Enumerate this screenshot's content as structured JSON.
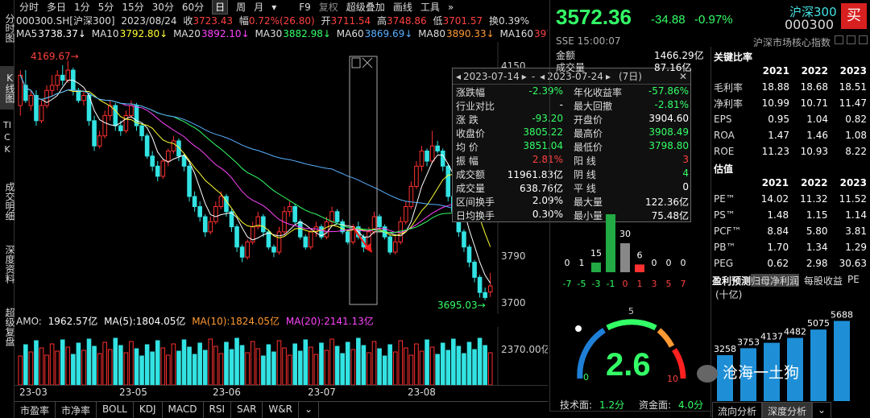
{
  "left_tabs": [
    {
      "label": "分时图",
      "active": false
    },
    {
      "label": "K线图",
      "active": true
    },
    {
      "label": "TICK",
      "active": false
    },
    {
      "label": "成交明细",
      "active": false
    },
    {
      "label": "深度资料",
      "active": false
    },
    {
      "label": "超级复盘",
      "active": false
    }
  ],
  "toolbar": {
    "periods": [
      "分时",
      "多日",
      "1分",
      "5分",
      "15分",
      "30分",
      "60分",
      "日",
      "周",
      "月"
    ],
    "selected": "日",
    "more": "▾",
    "right": [
      "F9",
      "复权",
      "超级叠加",
      "画线",
      "工具"
    ],
    "chevron": "»"
  },
  "info": {
    "code": "000300.SH[沪深300]",
    "date": "2023/08/24",
    "close_label": "收",
    "close": "3723.43",
    "amp_label": "幅",
    "amp": "0.72%(26.80)",
    "open_label": "开",
    "open": "3711.54",
    "high_label": "高",
    "high": "3748.86",
    "low_label": "低",
    "low": "3701.57",
    "turnover_label": "换",
    "turnover": "0.39%"
  },
  "ma": [
    {
      "name": "MA5",
      "value": "3738.37↓",
      "color": "#ffffff"
    },
    {
      "name": "MA10",
      "value": "3792.80↓",
      "color": "#ffff33"
    },
    {
      "name": "MA20",
      "value": "3892.10↓",
      "color": "#ff44ff"
    },
    {
      "name": "MA30",
      "value": "3882.98↓",
      "color": "#33ff66"
    },
    {
      "name": "MA60",
      "value": "3869.69↓",
      "color": "#58b0ff"
    },
    {
      "name": "MA80",
      "value": "3890.33↓",
      "color": "#ff9933"
    },
    {
      "name": "MA160",
      "value": "3974.2",
      "color": "#ff4040"
    }
  ],
  "chart_data": {
    "type": "candlestick",
    "ylim": [
      3680,
      4190
    ],
    "y_ticks": [
      "4150",
      "3790",
      "3700"
    ],
    "x_ticks": [
      "23-03",
      "23-05",
      "23-06",
      "23-07",
      "23-08"
    ],
    "annotations": {
      "max_label": "4169.67→",
      "min_label": "3695.03→"
    },
    "candles": [
      [
        4080,
        4140,
        4060,
        4150
      ],
      [
        4120,
        4090,
        4085,
        4150
      ],
      [
        4080,
        4100,
        4070,
        4110
      ],
      [
        4100,
        4050,
        4040,
        4110
      ],
      [
        4050,
        4080,
        4045,
        4090
      ],
      [
        4080,
        4110,
        4075,
        4120
      ],
      [
        4110,
        4120,
        4100,
        4140
      ],
      [
        4120,
        4140,
        4110,
        4150
      ],
      [
        4140,
        4130,
        4120,
        4160
      ],
      [
        4130,
        4150,
        4125,
        4169
      ],
      [
        4150,
        4110,
        4100,
        4155
      ],
      [
        4110,
        4090,
        4085,
        4115
      ],
      [
        4090,
        4100,
        4080,
        4110
      ],
      [
        4100,
        4050,
        4040,
        4105
      ],
      [
        4050,
        4000,
        3990,
        4060
      ],
      [
        4000,
        4020,
        3995,
        4030
      ],
      [
        4020,
        4060,
        4015,
        4070
      ],
      [
        4060,
        4080,
        4050,
        4090
      ],
      [
        4080,
        4040,
        4030,
        4085
      ],
      [
        4040,
        4030,
        4020,
        4050
      ],
      [
        4030,
        4060,
        4025,
        4070
      ],
      [
        4060,
        4080,
        4055,
        4090
      ],
      [
        4080,
        4040,
        4030,
        4085
      ],
      [
        4040,
        4020,
        4010,
        4045
      ],
      [
        4020,
        3980,
        3975,
        4025
      ],
      [
        3980,
        3960,
        3950,
        3990
      ],
      [
        3960,
        3940,
        3930,
        3970
      ],
      [
        3940,
        3970,
        3935,
        3975
      ],
      [
        3970,
        3990,
        3960,
        3995
      ],
      [
        3990,
        4010,
        3985,
        4020
      ],
      [
        4010,
        3980,
        3970,
        4015
      ],
      [
        3980,
        3960,
        3950,
        3985
      ],
      [
        3960,
        3900,
        3890,
        3965
      ],
      [
        3900,
        3880,
        3870,
        3910
      ],
      [
        3880,
        3860,
        3850,
        3890
      ],
      [
        3860,
        3830,
        3820,
        3865
      ],
      [
        3830,
        3850,
        3825,
        3860
      ],
      [
        3850,
        3880,
        3845,
        3890
      ],
      [
        3880,
        3900,
        3875,
        3910
      ],
      [
        3900,
        3870,
        3860,
        3905
      ],
      [
        3870,
        3840,
        3830,
        3875
      ],
      [
        3840,
        3800,
        3790,
        3845
      ],
      [
        3800,
        3780,
        3770,
        3805
      ],
      [
        3780,
        3810,
        3775,
        3815
      ],
      [
        3810,
        3840,
        3805,
        3850
      ],
      [
        3840,
        3860,
        3835,
        3870
      ],
      [
        3860,
        3830,
        3820,
        3865
      ],
      [
        3830,
        3800,
        3795,
        3835
      ],
      [
        3800,
        3790,
        3780,
        3805
      ],
      [
        3790,
        3830,
        3785,
        3840
      ],
      [
        3830,
        3870,
        3825,
        3880
      ],
      [
        3870,
        3880,
        3860,
        3890
      ],
      [
        3880,
        3850,
        3845,
        3885
      ],
      [
        3850,
        3820,
        3815,
        3855
      ],
      [
        3820,
        3800,
        3795,
        3825
      ],
      [
        3800,
        3830,
        3795,
        3835
      ],
      [
        3830,
        3840,
        3820,
        3850
      ],
      [
        3840,
        3820,
        3815,
        3845
      ],
      [
        3820,
        3850,
        3815,
        3860
      ],
      [
        3850,
        3870,
        3845,
        3880
      ],
      [
        3870,
        3850,
        3845,
        3875
      ],
      [
        3850,
        3830,
        3825,
        3855
      ],
      [
        3830,
        3810,
        3805,
        3835
      ],
      [
        3810,
        3840,
        3805,
        3845
      ],
      [
        3840,
        3820,
        3815,
        3850
      ],
      [
        3820,
        3800,
        3790,
        3825
      ],
      [
        3800,
        3830,
        3795,
        3840
      ],
      [
        3830,
        3860,
        3825,
        3870
      ],
      [
        3860,
        3840,
        3835,
        3865
      ],
      [
        3840,
        3820,
        3815,
        3845
      ],
      [
        3820,
        3790,
        3785,
        3825
      ],
      [
        3790,
        3810,
        3785,
        3820
      ],
      [
        3810,
        3850,
        3805,
        3860
      ],
      [
        3850,
        3880,
        3845,
        3890
      ],
      [
        3880,
        3920,
        3875,
        3930
      ],
      [
        3920,
        3960,
        3915,
        3970
      ],
      [
        3960,
        3990,
        3950,
        4000
      ],
      [
        3990,
        3970,
        3960,
        3995
      ],
      [
        3970,
        4000,
        3965,
        4030
      ],
      [
        4000,
        3990,
        3985,
        4010
      ],
      [
        3990,
        3960,
        3950,
        3995
      ],
      [
        3960,
        3900,
        3890,
        3965
      ],
      [
        3900,
        3870,
        3860,
        3905
      ],
      [
        3870,
        3830,
        3820,
        3875
      ],
      [
        3830,
        3800,
        3790,
        3835
      ],
      [
        3800,
        3770,
        3760,
        3805
      ],
      [
        3770,
        3740,
        3730,
        3775
      ],
      [
        3740,
        3710,
        3700,
        3745
      ],
      [
        3710,
        3700,
        3695,
        3720
      ],
      [
        3711,
        3723,
        3701,
        3749
      ]
    ],
    "volume": {
      "label": "AMO",
      "value": "1962.57亿",
      "ma5": "1804.05亿",
      "ma10": "1824.05亿",
      "ma20": "2141.13亿",
      "tick": "2370.00亿"
    }
  },
  "popup": {
    "start": "2023-07-14",
    "end": "2023-07-24",
    "days": "(7日)",
    "left": [
      [
        "涨跌幅",
        "-2.39%",
        "green"
      ],
      [
        "行业对比",
        "-",
        "white"
      ],
      [
        "涨  跌",
        "-93.20",
        "green"
      ],
      [
        "收盘价",
        "3805.22",
        "green"
      ],
      [
        "均  价",
        "3851.04",
        "green"
      ],
      [
        "振  幅",
        "2.81%",
        "red"
      ],
      [
        "成交额",
        "11961.83亿",
        "white"
      ],
      [
        "成交量",
        "638.76亿",
        "white"
      ],
      [
        "区间换手",
        "2.09%",
        "white"
      ],
      [
        "日均换手",
        "0.30%",
        "white"
      ]
    ],
    "right": [
      [
        "年化收益率",
        "-57.86%",
        "green"
      ],
      [
        "最大回撤",
        "-2.81%",
        "green"
      ],
      [
        "开盘价",
        "3904.60",
        "white"
      ],
      [
        "最高价",
        "3908.49",
        "green"
      ],
      [
        "最低价",
        "3798.80",
        "green"
      ],
      [
        "阳  线",
        "3",
        "red"
      ],
      [
        "阴  线",
        "4",
        "green"
      ],
      [
        "平  线",
        "0",
        "white"
      ],
      [
        "最大量",
        "122.36亿",
        "white"
      ],
      [
        "最小量",
        "75.48亿",
        "white"
      ]
    ]
  },
  "quote": {
    "price": "3572.36",
    "change": "-34.88",
    "pct": "-0.97%",
    "name": "沪深300",
    "code": "000300",
    "exchange": "SSE 15:00:07",
    "index_type": "沪深市场核心指数",
    "buy": "买",
    "amount_label": "金额",
    "amount": "1466.29亿",
    "row2_label": "成交量",
    "row2": "87.16亿"
  },
  "dist": {
    "values": [
      "0",
      "1",
      "15",
      "",
      "30",
      "6",
      "0",
      "0",
      "0"
    ],
    "labels": [
      "-7",
      "-5",
      "-3",
      "-1",
      "0",
      "1",
      "3",
      "5",
      "7"
    ],
    "bars": [
      0,
      0,
      15,
      90,
      45,
      12,
      0,
      0,
      0
    ]
  },
  "gauge": {
    "value": "2.6",
    "min": "0",
    "mid": "5",
    "max": "10",
    "tech_label": "技术面:",
    "tech": "1.2分",
    "fund_label": "资金面:",
    "fund": "4.0分"
  },
  "finance": {
    "title": "关键比率",
    "years": [
      "2021",
      "2022",
      "2023"
    ],
    "rows": [
      [
        "毛利率",
        "18.88",
        "18.68",
        "18.51"
      ],
      [
        "净利率",
        "10.99",
        "10.71",
        "11.47"
      ],
      [
        "EPS",
        "0.95",
        "1.04",
        "0.82"
      ],
      [
        "ROA",
        "1.47",
        "1.46",
        "1.08"
      ],
      [
        "ROE",
        "11.23",
        "10.93",
        "8.22"
      ]
    ]
  },
  "valuation": {
    "title": "估值",
    "years": [
      "2021",
      "2022",
      "2023"
    ],
    "rows": [
      [
        "PE™",
        "14.02",
        "11.32",
        "11.52"
      ],
      [
        "PS™",
        "1.48",
        "1.15",
        "1.14"
      ],
      [
        "PCF™",
        "8.84",
        "5.80",
        "3.81"
      ],
      [
        "PB™",
        "1.70",
        "1.34",
        "1.29"
      ],
      [
        "PEG",
        "0.62",
        "2.98",
        "30.63"
      ]
    ]
  },
  "forecast": {
    "tabs": [
      "盈利预测",
      "归母净利润",
      "每股收益",
      "PE"
    ],
    "unit": "(十亿)",
    "values": [
      "3258",
      "3753",
      "4137",
      "4482",
      "5075",
      "5688"
    ],
    "bars": [
      3258,
      3753,
      4137,
      4482,
      5075,
      5688
    ]
  },
  "right_bottom_tabs": [
    "流向分析",
    "深度分析"
  ],
  "watermark": "沧海一土狗"
}
